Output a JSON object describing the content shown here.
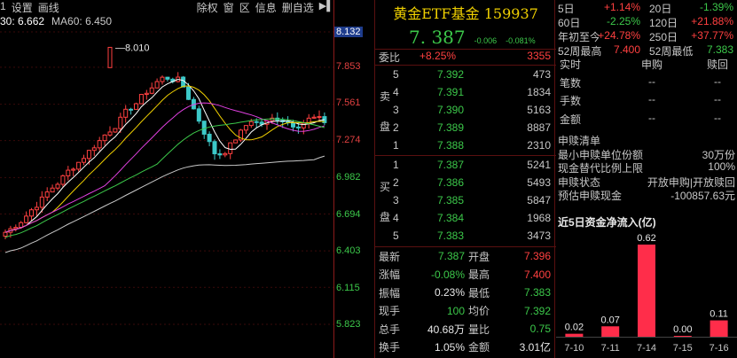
{
  "chart": {
    "menu_left": [
      "1",
      "设置",
      "画线"
    ],
    "menu_right": [
      "除权",
      "窗",
      "区",
      "信息",
      "删自选"
    ],
    "pin_icon": "pin-icon",
    "ma30_label": "30: 6.662",
    "ma60_label": "MA60: 6.450",
    "price_ticks": [
      "8.132",
      "7.853",
      "7.561",
      "7.274",
      "6.982",
      "6.694",
      "6.403",
      "6.115",
      "5.823"
    ],
    "peak_label": "8.010",
    "colors": {
      "up": "#ff4040",
      "down": "#3cc8c8",
      "ma5": "#ffffff",
      "ma10": "#f0d000",
      "ma20": "#e040e0",
      "ma30": "#3cc84a",
      "ma60": "#c8c8c8"
    }
  },
  "quote": {
    "title": "黄金ETF基金 159937",
    "price": "7. 387",
    "change": "-0.006",
    "change_pct": "-0.081%",
    "weibi_label": "委比",
    "weibi_pct": "+8.25%",
    "weibi_num": "3355",
    "sell_label": [
      "卖",
      "盘"
    ],
    "buy_label": [
      "买",
      "盘"
    ],
    "asks": [
      {
        "level": "5",
        "price": "7.392",
        "vol": "473"
      },
      {
        "level": "4",
        "price": "7.391",
        "vol": "1834"
      },
      {
        "level": "3",
        "price": "7.390",
        "vol": "5163"
      },
      {
        "level": "2",
        "price": "7.389",
        "vol": "8887"
      },
      {
        "level": "1",
        "price": "7.388",
        "vol": "2310"
      }
    ],
    "bids": [
      {
        "level": "1",
        "price": "7.387",
        "vol": "5241"
      },
      {
        "level": "2",
        "price": "7.386",
        "vol": "5493"
      },
      {
        "level": "3",
        "price": "7.385",
        "vol": "5847"
      },
      {
        "level": "4",
        "price": "7.384",
        "vol": "1968"
      },
      {
        "level": "5",
        "price": "7.383",
        "vol": "3473"
      }
    ],
    "stats": [
      {
        "k1": "最新",
        "v1": "7.387",
        "c1": "green",
        "k2": "开盘",
        "v2": "7.396",
        "c2": "red"
      },
      {
        "k1": "涨幅",
        "v1": "-0.08%",
        "c1": "green",
        "k2": "最高",
        "v2": "7.400",
        "c2": "red"
      },
      {
        "k1": "振幅",
        "v1": "0.23%",
        "c1": "white",
        "k2": "最低",
        "v2": "7.383",
        "c2": "green"
      },
      {
        "k1": "现手",
        "v1": "100",
        "c1": "green",
        "k2": "均价",
        "v2": "7.392",
        "c2": "green"
      },
      {
        "k1": "总手",
        "v1": "40.68万",
        "c1": "white",
        "k2": "量比",
        "v2": "0.75",
        "c2": "green"
      },
      {
        "k1": "换手",
        "v1": "1.05%",
        "c1": "white",
        "k2": "金额",
        "v2": "3.01亿",
        "c2": "white"
      }
    ]
  },
  "info": {
    "perf": [
      {
        "k1": "5日",
        "v1": "+1.14%",
        "c1": "red",
        "k2": "20日",
        "v2": "-1.39%",
        "c2": "green"
      },
      {
        "k1": "60日",
        "v1": "-2.25%",
        "c1": "green",
        "k2": "120日",
        "v2": "+21.88%",
        "c2": "red"
      },
      {
        "k1": "年初至今",
        "v1": "+24.78%",
        "c1": "red",
        "k2": "250日",
        "v2": "+37.77%",
        "c2": "red"
      },
      {
        "k1": "52周最高",
        "v1": "7.400",
        "c1": "red",
        "k2": "52周最低",
        "v2": "7.383",
        "c2": "green"
      }
    ],
    "sub_header": [
      "实时",
      "申购",
      "赎回"
    ],
    "sub_rows": [
      [
        "笔数",
        "--",
        "--"
      ],
      [
        "手数",
        "--",
        "--"
      ],
      [
        "金额",
        "--",
        "--"
      ]
    ],
    "subscribe_list": [
      {
        "k": "申赎清单",
        "v": ""
      },
      {
        "k": "最小申赎单位份额",
        "v": "30万份"
      },
      {
        "k": "现金替代比例上限",
        "v": "100%"
      },
      {
        "k": "申赎状态",
        "v": "开放申购|开放赎回"
      },
      {
        "k": "预估申赎现金",
        "v": "-100857.63元"
      }
    ],
    "flow_title": "近5日资金净流入(亿)"
  },
  "chart_data": {
    "type": "bar",
    "categories": [
      "7-10",
      "7-11",
      "7-14",
      "7-15",
      "7-16"
    ],
    "values": [
      0.02,
      0.07,
      0.62,
      0.0,
      0.11
    ],
    "value_labels": [
      "0.02",
      "0.07",
      "0.62",
      "0.00",
      "0.11"
    ],
    "title": "近5日资金净流入(亿)",
    "ylim": [
      0,
      0.62
    ]
  }
}
